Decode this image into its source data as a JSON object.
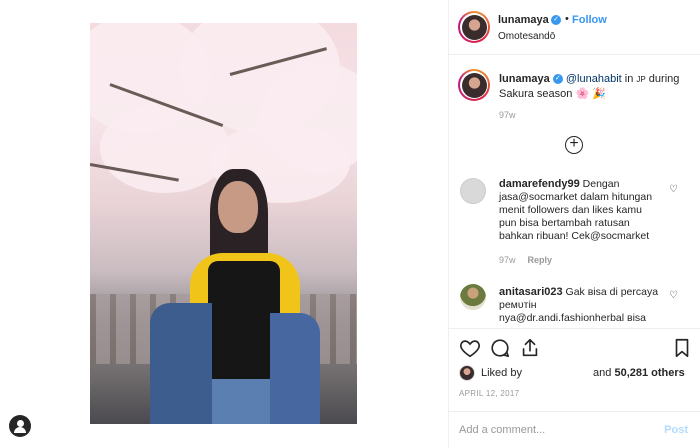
{
  "header": {
    "username": "lunamaya",
    "dot": "•",
    "follow_label": "Follow",
    "location": "Omotesandō"
  },
  "caption": {
    "username": "lunamaya",
    "mention": "@lunahabit",
    "text_in": "in",
    "flag": "JP",
    "text_rest": "during Sakura season",
    "emoji": "🌸 🎉",
    "time": "97w"
  },
  "comments": [
    {
      "username": "damarefendy99",
      "text": "Dengan jasa@socmarket dalam hitungan menit followers dan likes kamu pun bisa bertambah ratusan bahkan ribuan! Cek@socmarket",
      "time": "97w",
      "reply_label": "Reply"
    },
    {
      "username": "anitasari023",
      "text": "Gak вisa di percaya ремυтін nya@dr.andi.fashionherbal вisa"
    }
  ],
  "likes": {
    "prefix": "Liked by",
    "suffix_and": "and",
    "count": "50,281 others"
  },
  "date": "APRIL 12, 2017",
  "add_comment": {
    "placeholder": "Add a comment...",
    "post_label": "Post"
  },
  "colors": {
    "accent": "#3897f0",
    "muted": "#999999",
    "border": "#efefef"
  }
}
